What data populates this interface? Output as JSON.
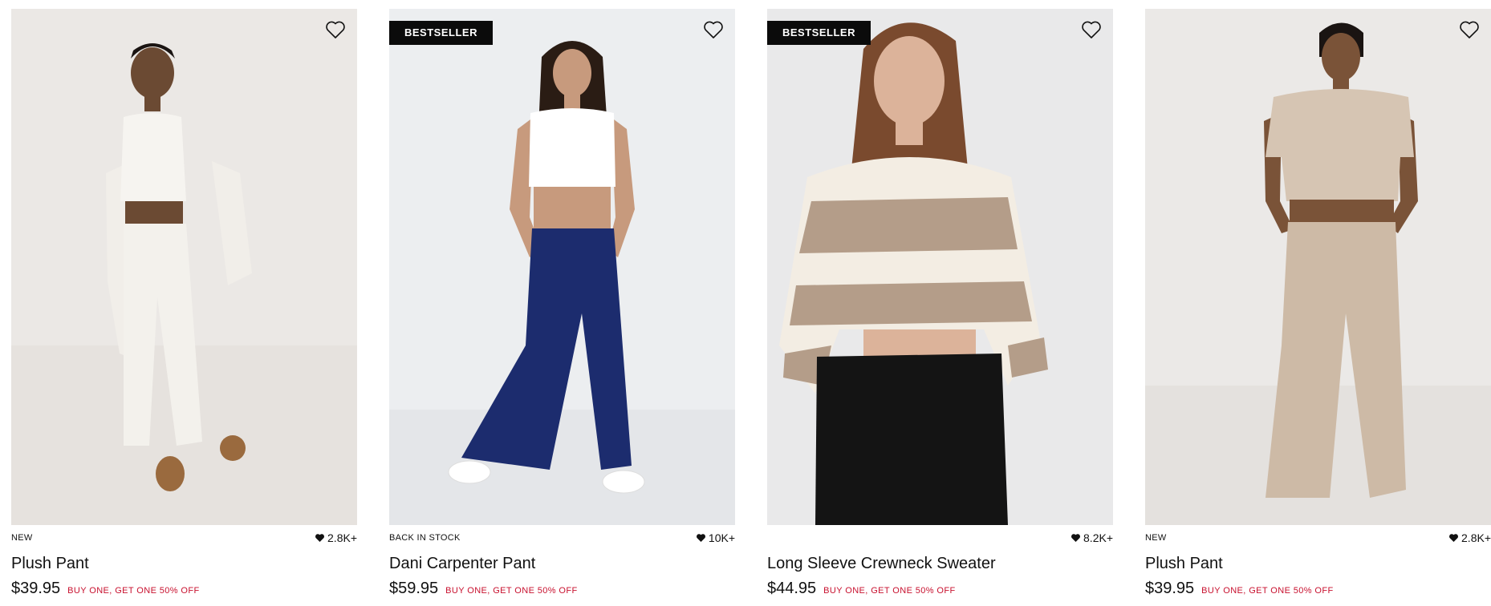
{
  "products": [
    {
      "badge": "",
      "tag": "NEW",
      "likes": "2.8K+",
      "name": "Plush Pant",
      "price": "$39.95",
      "promo": "BUY ONE, GET ONE 50% OFF",
      "image": {
        "bg": "#ece9e6",
        "top": "#f4f2ee",
        "bottom": "#f1efeb",
        "accent": "#9a6a3e",
        "skin": "#6b4a33"
      }
    },
    {
      "badge": "BESTSELLER",
      "tag": "BACK IN STOCK",
      "likes": "10K+",
      "name": "Dani Carpenter Pant",
      "price": "$59.95",
      "promo": "BUY ONE, GET ONE 50% OFF",
      "image": {
        "bg": "#eceef0",
        "top": "#ffffff",
        "bottom": "#1c2c6e",
        "accent": "#ffffff",
        "skin": "#c79a7d"
      }
    },
    {
      "badge": "BESTSELLER",
      "tag": "",
      "likes": "8.2K+",
      "name": "Long Sleeve Crewneck Sweater",
      "price": "$44.95",
      "promo": "BUY ONE, GET ONE 50% OFF",
      "image": {
        "bg": "#e9e9ea",
        "top": "#b49d89",
        "bottom": "#141414",
        "accent": "#f3ede3",
        "skin": "#dcb39a"
      }
    },
    {
      "badge": "",
      "tag": "NEW",
      "likes": "2.8K+",
      "name": "Plush Pant",
      "price": "$39.95",
      "promo": "BUY ONE, GET ONE 50% OFF",
      "image": {
        "bg": "#ebe9e7",
        "top": "#d6c5b3",
        "bottom": "#cdbaa6",
        "accent": "#d6c5b3",
        "skin": "#7a5338"
      }
    }
  ]
}
